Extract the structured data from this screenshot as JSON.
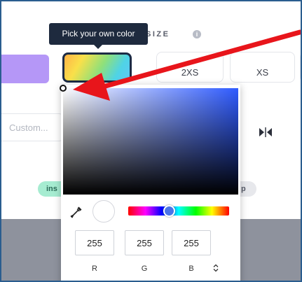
{
  "tooltip": {
    "text": "Pick your own color"
  },
  "size_section": {
    "label": "SIZE",
    "info_glyph": "i"
  },
  "swatches": [
    {
      "name": "purple",
      "color": "#b597f7"
    },
    {
      "name": "custom-rainbow",
      "selected": true
    }
  ],
  "sizes": [
    {
      "label": "2XS"
    },
    {
      "label": "XS"
    }
  ],
  "custom_input": {
    "placeholder": "Custom..."
  },
  "pills": [
    {
      "label": "ins",
      "color": "#a6ecd1"
    },
    {
      "label": "p",
      "color": "#e7e8ec"
    }
  ],
  "color_picker": {
    "hue_color": "#2f5bff",
    "hue_position": 0.4,
    "preview_color": "#ffffff",
    "rgb": {
      "r": "255",
      "g": "255",
      "b": "255"
    },
    "labels": {
      "r": "R",
      "g": "G",
      "b": "B"
    }
  },
  "icons": {
    "eyedropper": "eyedropper-icon",
    "flip": "flip-horizontal-icon",
    "mode_toggle": "sort-arrows-icon",
    "info": "info-icon"
  },
  "annotation": {
    "color": "#e8151b"
  }
}
